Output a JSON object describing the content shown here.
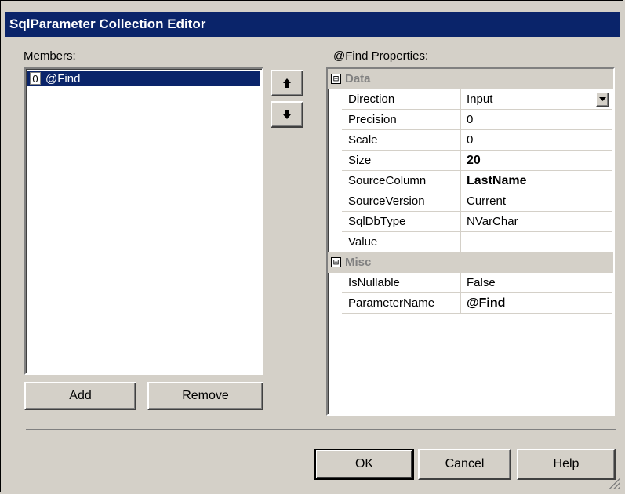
{
  "window": {
    "title": "SqlParameter Collection Editor"
  },
  "members": {
    "label": "Members:",
    "items": [
      {
        "index": "0",
        "name": "@Find",
        "selected": true
      }
    ]
  },
  "buttons": {
    "move_up_icon": "up-arrow-icon",
    "move_down_icon": "down-arrow-icon",
    "add": "Add",
    "remove": "Remove",
    "ok": "OK",
    "cancel": "Cancel",
    "help": "Help"
  },
  "properties": {
    "label": "@Find Properties:",
    "categories": [
      {
        "name": "Data",
        "toggle": "⊟",
        "rows": [
          {
            "name": "Direction",
            "value": "Input",
            "bold": false,
            "dropdown": true
          },
          {
            "name": "Precision",
            "value": "0",
            "bold": false
          },
          {
            "name": "Scale",
            "value": "0",
            "bold": false
          },
          {
            "name": "Size",
            "value": "20",
            "bold": true
          },
          {
            "name": "SourceColumn",
            "value": "LastName",
            "bold": true
          },
          {
            "name": "SourceVersion",
            "value": "Current",
            "bold": false
          },
          {
            "name": "SqlDbType",
            "value": "NVarChar",
            "bold": false
          },
          {
            "name": "Value",
            "value": "",
            "bold": false
          }
        ]
      },
      {
        "name": "Misc",
        "toggle": "⊟",
        "rows": [
          {
            "name": "IsNullable",
            "value": "False",
            "bold": false
          },
          {
            "name": "ParameterName",
            "value": "@Find",
            "bold": true
          }
        ]
      }
    ]
  },
  "colors": {
    "titlebar": "#0a246a",
    "dialog": "#d4d0c8",
    "selection": "#0a246a",
    "category_text": "#808080"
  }
}
